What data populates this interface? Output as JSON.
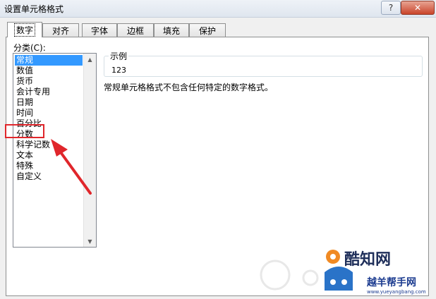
{
  "window": {
    "title": "设置单元格格式",
    "help_label": "?",
    "close_label": "✕"
  },
  "tabs": [
    {
      "label": "数字",
      "active": true
    },
    {
      "label": "对齐"
    },
    {
      "label": "字体"
    },
    {
      "label": "边框"
    },
    {
      "label": "填充"
    },
    {
      "label": "保护"
    }
  ],
  "category": {
    "label": "分类(C):",
    "items": [
      "常规",
      "数值",
      "货币",
      "会计专用",
      "日期",
      "时间",
      "百分比",
      "分数",
      "科学记数",
      "文本",
      "特殊",
      "自定义"
    ],
    "selected_index": 0
  },
  "sample": {
    "legend": "示例",
    "value": "123"
  },
  "description": "常规单元格格式不包含任何特定的数字格式。",
  "annotation": {
    "highlighted_item": "文本",
    "highlight_color": "#e0262b"
  },
  "watermark": {
    "brand": "酷知网",
    "site_name": "越羊帮手网",
    "site_url": "www.yueyangbang.com"
  },
  "colors": {
    "selection": "#3399ff",
    "close_button": "#c9442a"
  }
}
